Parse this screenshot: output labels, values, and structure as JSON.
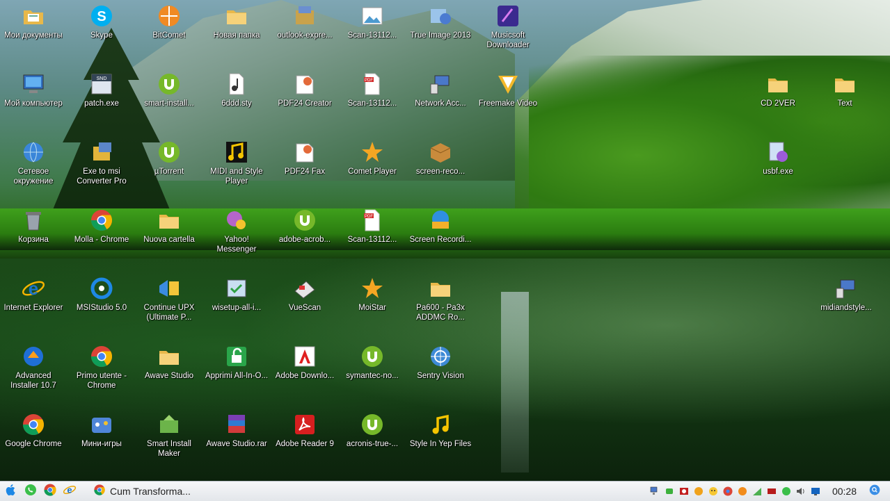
{
  "desktop": {
    "icons": [
      {
        "label": "Мои документы",
        "icon": "my-documents-icon"
      },
      {
        "label": "Skype",
        "icon": "skype-icon"
      },
      {
        "label": "BitComet",
        "icon": "bitcomet-icon"
      },
      {
        "label": "Новая папка",
        "icon": "folder-icon"
      },
      {
        "label": "outlook-expre...",
        "icon": "installer-icon"
      },
      {
        "label": "Scan-13112...",
        "icon": "image-file-icon"
      },
      {
        "label": "True Image 2013",
        "icon": "true-image-icon"
      },
      {
        "label": "Musicsoft Downloader",
        "icon": "music-downloader-icon"
      },
      {
        "label": "Мой компьютер",
        "icon": "my-computer-icon"
      },
      {
        "label": "patch.exe",
        "icon": "exe-file-icon"
      },
      {
        "label": "smart-install...",
        "icon": "utorrent-file-icon"
      },
      {
        "label": "6ddd.sty",
        "icon": "sty-file-icon"
      },
      {
        "label": "PDF24 Creator",
        "icon": "pdf24-icon"
      },
      {
        "label": "Scan-13112...",
        "icon": "pdf-file-icon"
      },
      {
        "label": "Network Acc...",
        "icon": "network-icon"
      },
      {
        "label": "Freemake Video",
        "icon": "freemake-icon"
      },
      {
        "label": "CD 2VER",
        "icon": "folder-icon"
      },
      {
        "label": "Text",
        "icon": "folder-icon"
      },
      {
        "label": "Сетевое окружение",
        "icon": "network-globe-icon"
      },
      {
        "label": "Exe to msi Converter Pro",
        "icon": "package-icon"
      },
      {
        "label": "µTorrent",
        "icon": "utorrent-icon"
      },
      {
        "label": "MIDI and Style Player",
        "icon": "midi-player-icon"
      },
      {
        "label": "PDF24 Fax",
        "icon": "pdf24-icon"
      },
      {
        "label": "Comet Player",
        "icon": "star-icon"
      },
      {
        "label": "screen-reco...",
        "icon": "box-icon"
      },
      {
        "label": "usbf.exe",
        "icon": "usb-exe-icon"
      },
      {
        "label": "Корзина",
        "icon": "recycle-bin-icon"
      },
      {
        "label": "Molla - Chrome",
        "icon": "chrome-icon"
      },
      {
        "label": "Nuova cartella",
        "icon": "folder-icon"
      },
      {
        "label": "Yahoo! Messenger",
        "icon": "yahoo-messenger-icon"
      },
      {
        "label": "adobe-acrob...",
        "icon": "utorrent-file-icon"
      },
      {
        "label": "Scan-13112...",
        "icon": "pdf-file-icon"
      },
      {
        "label": "Screen Recordi...",
        "icon": "screen-recorder-icon"
      },
      {
        "label": "Internet Explorer",
        "icon": "internet-explorer-icon"
      },
      {
        "label": "MSIStudio 5.0",
        "icon": "msistudio-icon"
      },
      {
        "label": "Continue UPX (Ultimate P...",
        "icon": "upx-icon"
      },
      {
        "label": "wisetup-all-i...",
        "icon": "setup-icon"
      },
      {
        "label": "VueScan",
        "icon": "vuescan-icon"
      },
      {
        "label": "MoiStar",
        "icon": "star-icon"
      },
      {
        "label": "Pa600 - Pa3x ADDMC Ro...",
        "icon": "folder-icon"
      },
      {
        "label": "midiandstyle...",
        "icon": "network-icon"
      },
      {
        "label": "Advanced Installer 10.7",
        "icon": "advanced-installer-icon"
      },
      {
        "label": "Primo utente - Chrome",
        "icon": "chrome-icon"
      },
      {
        "label": "Awave Studio",
        "icon": "folder-icon"
      },
      {
        "label": "Apprimi All-In-O...",
        "icon": "lock-open-icon"
      },
      {
        "label": "Adobe Downlo...",
        "icon": "adobe-icon"
      },
      {
        "label": "symantec-no...",
        "icon": "utorrent-file-icon"
      },
      {
        "label": "Sentry Vision",
        "icon": "sentry-icon"
      },
      {
        "label": "Google Chrome",
        "icon": "chrome-icon"
      },
      {
        "label": "Мини-игры",
        "icon": "games-icon"
      },
      {
        "label": "Smart Install Maker",
        "icon": "smart-install-icon"
      },
      {
        "label": "Awave Studio.rar",
        "icon": "rar-archive-icon"
      },
      {
        "label": "Adobe Reader 9",
        "icon": "adobe-reader-icon"
      },
      {
        "label": "acronis-true-...",
        "icon": "utorrent-file-icon"
      },
      {
        "label": "Style In Yep Files",
        "icon": "music-note-icon"
      }
    ]
  },
  "taskbar": {
    "start_icon": "apple-icon",
    "quick_launch": [
      "whatsapp-icon",
      "chrome-icon",
      "ie-icon"
    ],
    "active_task": {
      "label": "Cum Transforma...",
      "icon": "chrome-icon"
    },
    "tray_icons": [
      "network-icon",
      "usb-icon",
      "record-icon",
      "globe-icon",
      "emoji-icon",
      "chrome-icon",
      "orange-icon",
      "signal-icon",
      "battery-icon",
      "whatsapp-icon",
      "volume-icon",
      "display-icon"
    ],
    "clock": "00:28",
    "search_icon": "search-icon"
  }
}
